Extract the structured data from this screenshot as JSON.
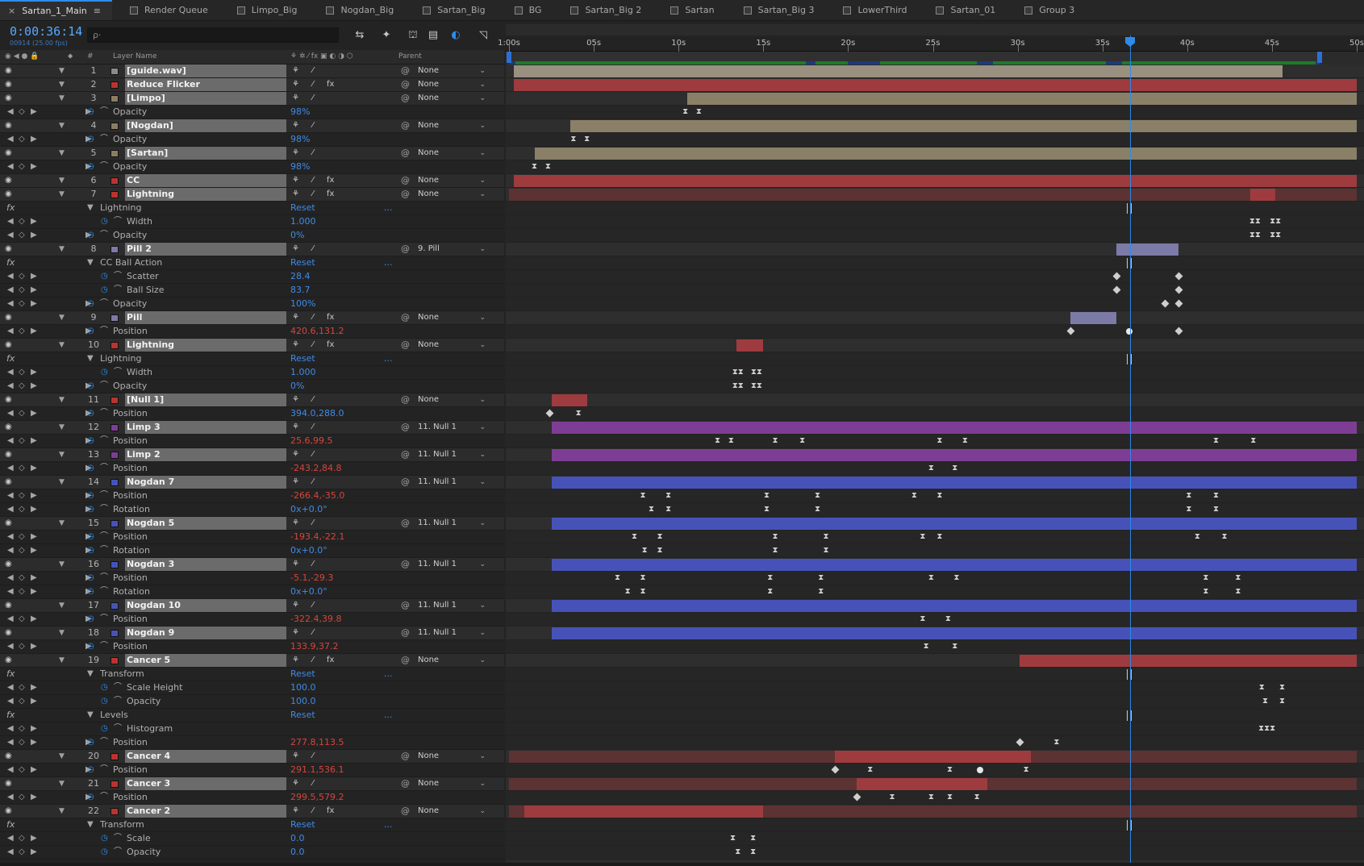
{
  "tabs": [
    {
      "label": "Sartan_1_Main",
      "active": true
    },
    {
      "label": "Render Queue"
    },
    {
      "label": "Limpo_Big"
    },
    {
      "label": "Nogdan_Big"
    },
    {
      "label": "Sartan_Big"
    },
    {
      "label": "BG"
    },
    {
      "label": "Sartan_Big 2"
    },
    {
      "label": "Sartan"
    },
    {
      "label": "Sartan_Big 3"
    },
    {
      "label": "LowerThird"
    },
    {
      "label": "Sartan_01"
    },
    {
      "label": "Group 3"
    }
  ],
  "timecode": "0:00:36:14",
  "fps": "00914 (25.00 fps)",
  "search_placeholder": "ρ·",
  "columns": {
    "number": "#",
    "layer_name": "Layer Name",
    "parent": "Parent"
  },
  "ruler": [
    "1:00s",
    "05s",
    "10s",
    "15s",
    "20s",
    "25s",
    "30s",
    "35s",
    "40s",
    "45s",
    "50s"
  ],
  "rows": [
    {
      "type": "layer",
      "num": "1",
      "name": "[guide.wav]",
      "label": "#8a8a8a",
      "parent": "None"
    },
    {
      "type": "layer",
      "num": "2",
      "name": "Reduce Flicker",
      "label": "#b8342e",
      "parent": "None",
      "fx": true
    },
    {
      "type": "layer",
      "num": "3",
      "name": "[Limpo]",
      "label": "#8a7e62",
      "parent": "None"
    },
    {
      "type": "prop",
      "name": "Opacity",
      "value": "98%"
    },
    {
      "type": "layer",
      "num": "4",
      "name": "[Nogdan]",
      "label": "#8a7e62",
      "parent": "None"
    },
    {
      "type": "prop",
      "name": "Opacity",
      "value": "98%"
    },
    {
      "type": "layer",
      "num": "5",
      "name": "[Sartan]",
      "label": "#8a7e62",
      "parent": "None"
    },
    {
      "type": "prop",
      "name": "Opacity",
      "value": "98%"
    },
    {
      "type": "layer",
      "num": "6",
      "name": "CC",
      "label": "#b8342e",
      "parent": "None",
      "fx": true
    },
    {
      "type": "layer",
      "num": "7",
      "name": "Lightning",
      "label": "#b8342e",
      "parent": "None",
      "fx": true
    },
    {
      "type": "fx",
      "name": "Lightning",
      "reset": "Reset"
    },
    {
      "type": "prop",
      "name": "Width",
      "value": "1.000",
      "indent": 2
    },
    {
      "type": "prop",
      "name": "Opacity",
      "value": "0%",
      "indent": 1
    },
    {
      "type": "layer",
      "num": "8",
      "name": "Pill 2",
      "label": "#7c7aa6",
      "parent": "9. Pill"
    },
    {
      "type": "fx",
      "name": "CC Ball Action",
      "reset": "Reset"
    },
    {
      "type": "prop",
      "name": "Scatter",
      "value": "28.4",
      "indent": 2
    },
    {
      "type": "prop",
      "name": "Ball Size",
      "value": "83.7",
      "indent": 2
    },
    {
      "type": "prop",
      "name": "Opacity",
      "value": "100%",
      "indent": 1
    },
    {
      "type": "layer",
      "num": "9",
      "name": "Pill",
      "label": "#7c7aa6",
      "parent": "None",
      "fx": true
    },
    {
      "type": "prop",
      "name": "Position",
      "value": "420.6,131.2",
      "red": true,
      "indent": 1
    },
    {
      "type": "layer",
      "num": "10",
      "name": "Lightning",
      "label": "#b8342e",
      "parent": "None",
      "fx": true
    },
    {
      "type": "fx",
      "name": "Lightning",
      "reset": "Reset"
    },
    {
      "type": "prop",
      "name": "Width",
      "value": "1.000",
      "indent": 2
    },
    {
      "type": "prop",
      "name": "Opacity",
      "value": "0%",
      "indent": 1
    },
    {
      "type": "layer",
      "num": "11",
      "name": "[Null 1]",
      "label": "#b8342e",
      "parent": "None"
    },
    {
      "type": "prop",
      "name": "Position",
      "value": "394.0,288.0",
      "indent": 1
    },
    {
      "type": "layer",
      "num": "12",
      "name": "Limp 3",
      "label": "#7e3d94",
      "parent": "11. Null 1"
    },
    {
      "type": "prop",
      "name": "Position",
      "value": "25.6,99.5",
      "red": true,
      "indent": 1
    },
    {
      "type": "layer",
      "num": "13",
      "name": "Limp 2",
      "label": "#7e3d94",
      "parent": "11. Null 1"
    },
    {
      "type": "prop",
      "name": "Position",
      "value": "-243.2,84.8",
      "red": true,
      "indent": 1
    },
    {
      "type": "layer",
      "num": "14",
      "name": "Nogdan 7",
      "label": "#4752b8",
      "parent": "11. Null 1"
    },
    {
      "type": "prop",
      "name": "Position",
      "value": "-266.4,-35.0",
      "red": true,
      "indent": 1
    },
    {
      "type": "prop",
      "name": "Rotation",
      "value": "0x+0.0°",
      "indent": 1
    },
    {
      "type": "layer",
      "num": "15",
      "name": "Nogdan 5",
      "label": "#4752b8",
      "parent": "11. Null 1"
    },
    {
      "type": "prop",
      "name": "Position",
      "value": "-193.4,-22.1",
      "red": true,
      "indent": 1
    },
    {
      "type": "prop",
      "name": "Rotation",
      "value": "0x+0.0°",
      "indent": 1
    },
    {
      "type": "layer",
      "num": "16",
      "name": "Nogdan 3",
      "label": "#4752b8",
      "parent": "11. Null 1"
    },
    {
      "type": "prop",
      "name": "Position",
      "value": "-5.1,-29.3",
      "red": true,
      "indent": 1
    },
    {
      "type": "prop",
      "name": "Rotation",
      "value": "0x+0.0°",
      "indent": 1
    },
    {
      "type": "layer",
      "num": "17",
      "name": "Nogdan 10",
      "label": "#4752b8",
      "parent": "11. Null 1"
    },
    {
      "type": "prop",
      "name": "Position",
      "value": "-322.4,39.8",
      "red": true,
      "indent": 1
    },
    {
      "type": "layer",
      "num": "18",
      "name": "Nogdan 9",
      "label": "#4752b8",
      "parent": "11. Null 1"
    },
    {
      "type": "prop",
      "name": "Position",
      "value": "133.9,37.2",
      "red": true,
      "indent": 1
    },
    {
      "type": "layer",
      "num": "19",
      "name": "Cancer 5",
      "label": "#b8342e",
      "parent": "None",
      "fx": true
    },
    {
      "type": "fx",
      "name": "Transform",
      "reset": "Reset"
    },
    {
      "type": "prop",
      "name": "Scale Height",
      "value": "100.0",
      "indent": 2
    },
    {
      "type": "prop",
      "name": "Opacity",
      "value": "100.0",
      "indent": 2
    },
    {
      "type": "fx",
      "name": "Levels",
      "reset": "Reset"
    },
    {
      "type": "prop",
      "name": "Histogram",
      "value": "",
      "indent": 2
    },
    {
      "type": "prop",
      "name": "Position",
      "value": "277.8,113.5",
      "red": true,
      "indent": 1
    },
    {
      "type": "layer",
      "num": "20",
      "name": "Cancer 4",
      "label": "#b8342e",
      "parent": "None"
    },
    {
      "type": "prop",
      "name": "Position",
      "value": "291.1,536.1",
      "red": true,
      "indent": 1
    },
    {
      "type": "layer",
      "num": "21",
      "name": "Cancer 3",
      "label": "#b8342e",
      "parent": "None"
    },
    {
      "type": "prop",
      "name": "Position",
      "value": "299.5,579.2",
      "red": true,
      "indent": 1
    },
    {
      "type": "layer",
      "num": "22",
      "name": "Cancer 2",
      "label": "#b8342e",
      "parent": "None",
      "fx": true
    },
    {
      "type": "fx",
      "name": "Transform",
      "reset": "Reset"
    },
    {
      "type": "prop",
      "name": "Scale",
      "value": "0.0",
      "indent": 2
    },
    {
      "type": "prop",
      "name": "Opacity",
      "value": "0.0",
      "indent": 2
    }
  ]
}
